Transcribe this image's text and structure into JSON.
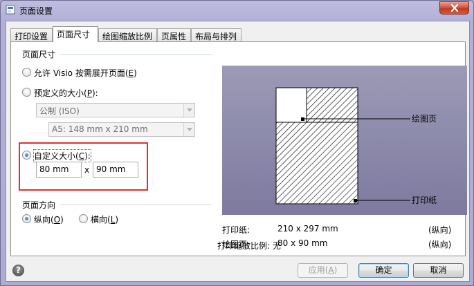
{
  "window": {
    "title": "页面设置"
  },
  "tabs": [
    {
      "label": "打印设置"
    },
    {
      "label": "页面尺寸"
    },
    {
      "label": "绘图缩放比例"
    },
    {
      "label": "页属性"
    },
    {
      "label": "布局与排列"
    }
  ],
  "page_size": {
    "group_label": "页面尺寸",
    "fit_option": {
      "label": "允许 Visio 按需展开页面(",
      "key": "E",
      "suffix": ")"
    },
    "predefined_option": {
      "label": "预定义的大小(",
      "key": "P",
      "suffix": "):"
    },
    "unit_select": {
      "value": "公制 (ISO)"
    },
    "size_select": {
      "value": "A5:  148 mm x 210 mm"
    },
    "custom_option": {
      "label": "自定义大小(",
      "key": "C",
      "suffix": "):"
    },
    "width": "80 mm",
    "times": "x",
    "height": "90 mm"
  },
  "orientation": {
    "group_label": "页面方向",
    "portrait": {
      "label": "纵向(",
      "key": "O",
      "suffix": ")"
    },
    "landscape": {
      "label": "横向(",
      "key": "L",
      "suffix": ")"
    }
  },
  "preview": {
    "drawing_page_label": "绘图页",
    "printer_paper_label": "打印纸"
  },
  "info": {
    "paper_label": "打印纸:",
    "paper_value": "210 x 297 mm",
    "paper_orient": "(纵向)",
    "drawing_label": "绘图页:",
    "drawing_value": "80 x 90 mm",
    "drawing_orient": "(纵向)",
    "zoom_text": "打印缩放比例: 无"
  },
  "buttons": {
    "apply": {
      "label": "应用(",
      "key": "A",
      "suffix": ")"
    },
    "ok": "确定",
    "cancel": "取消"
  },
  "colors": {
    "highlight": "#e03030",
    "preview_bg": "#8c89ab"
  }
}
